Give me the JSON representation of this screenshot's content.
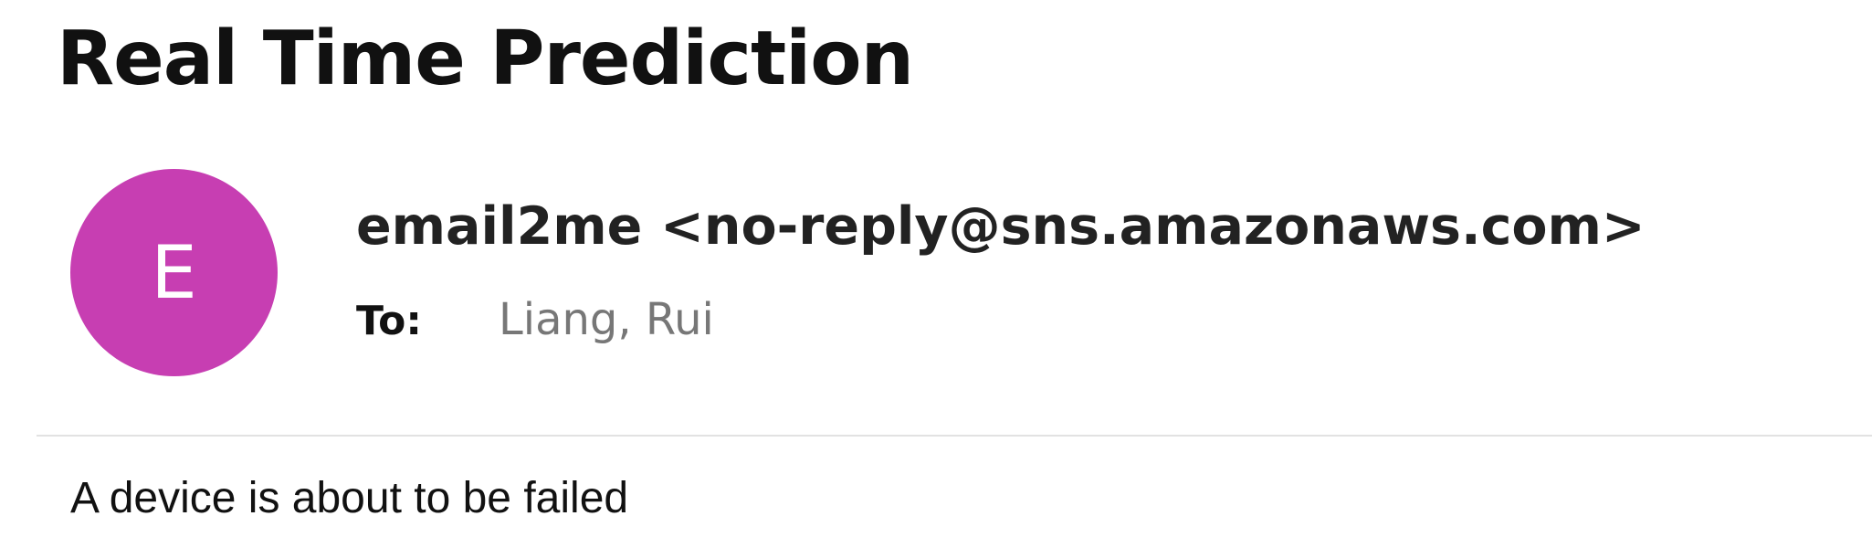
{
  "email": {
    "subject": "Real Time Prediction",
    "avatar": {
      "initial": "E",
      "color": "#c73eb2"
    },
    "sender": "email2me <no-reply@sns.amazonaws.com>",
    "to_label": "To:",
    "to_value": "Liang, Rui",
    "body": "A device is about to be failed"
  }
}
